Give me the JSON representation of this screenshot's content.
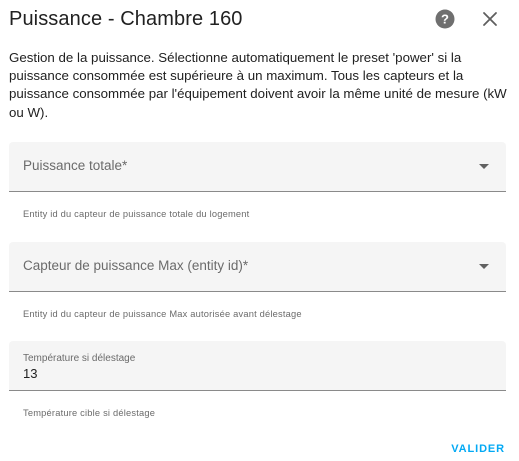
{
  "dialog": {
    "title": "Puissance - Chambre 160",
    "description": "Gestion de la puissance. Sélectionne automatiquement le preset 'power' si la puissance consommée est supérieure à un maximum. Tous les capteurs et la puissance consommée par l'équipement doivent avoir la même unité de mesure (kW ou W)."
  },
  "icons": {
    "help": "help-circle-icon",
    "close": "close-icon",
    "dropdown": "chevron-down-icon"
  },
  "fields": {
    "power_sensor": {
      "label": "Puissance totale*",
      "value": "",
      "helper": "Entity id du capteur de puissance totale du logement"
    },
    "max_power_sensor": {
      "label": "Capteur de puissance Max (entity id)*",
      "value": "",
      "helper": "Entity id du capteur de puissance Max autorisée avant délestage"
    },
    "shedding_temp": {
      "label": "Température si délestage",
      "value": "13",
      "helper": "Température cible si délestage"
    }
  },
  "actions": {
    "submit": "VALIDER"
  },
  "colors": {
    "accent": "#03a9f4",
    "field_background": "#f5f5f5",
    "secondary_text": "#6b6b6b"
  }
}
